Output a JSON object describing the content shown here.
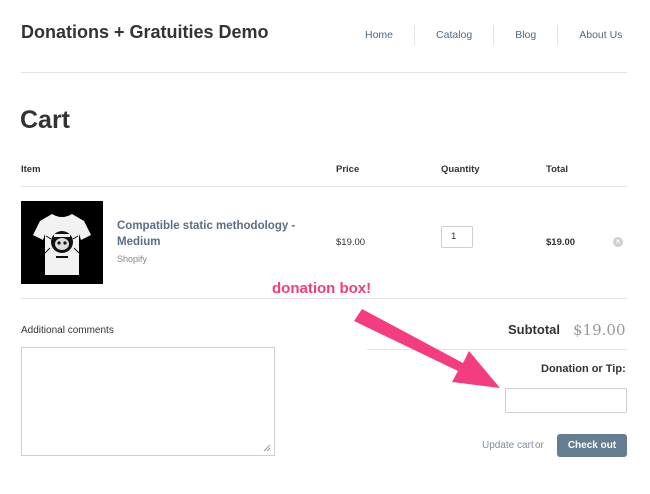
{
  "header": {
    "site_title": "Donations + Gratuities Demo",
    "nav": [
      "Home",
      "Catalog",
      "Blog",
      "About Us"
    ]
  },
  "page": {
    "title": "Cart"
  },
  "table": {
    "headers": {
      "item": "Item",
      "price": "Price",
      "quantity": "Quantity",
      "total": "Total"
    },
    "rows": [
      {
        "title": "Compatible static methodology - Medium",
        "vendor": "Shopify",
        "price": "$19.00",
        "quantity": "1",
        "total": "$19.00",
        "remove_icon": "circle-x-icon"
      }
    ]
  },
  "note": {
    "label": "Additional comments",
    "value": ""
  },
  "summary": {
    "subtotal_label": "Subtotal",
    "subtotal_value": "$19.00",
    "donation_label": "Donation or Tip:",
    "donation_value": ""
  },
  "actions": {
    "update_label": "Update cart",
    "or_text": "or",
    "checkout_label": "Check out"
  },
  "annotation": {
    "text": "donation box!",
    "color": "#f43c80"
  },
  "colors": {
    "link": "#4e6a80",
    "button": "#657d91",
    "subtotal_value": "#999999"
  }
}
